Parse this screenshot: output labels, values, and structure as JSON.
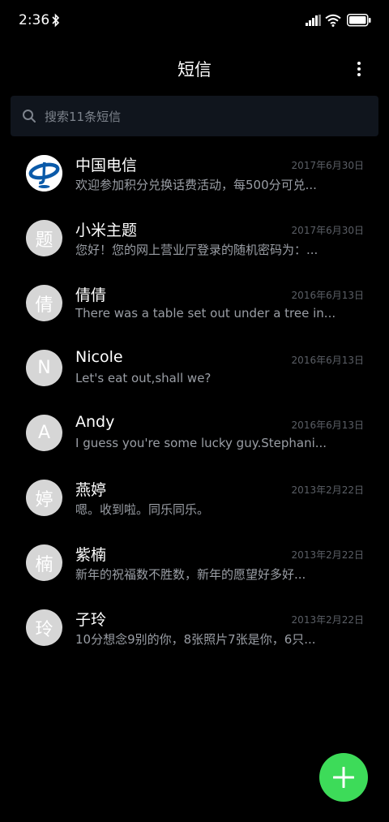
{
  "status_bar": {
    "time": "2:36",
    "icons": [
      "bluetooth-icon",
      "signal-icon",
      "wifi-icon",
      "battery-icon"
    ]
  },
  "header": {
    "title": "短信",
    "more_icon": "more-vertical-icon"
  },
  "search": {
    "placeholder": "搜索11条短信",
    "icon": "search-icon"
  },
  "threads": [
    {
      "name": "中国电信",
      "date": "2017年6月30日",
      "preview": "欢迎参加积分兑换话费活动，每500分可兑...",
      "avatar": "",
      "avatar_type": "china-telecom-logo"
    },
    {
      "name": "小米主题",
      "date": "2017年6月30日",
      "preview": "您好！您的网上营业厅登录的随机密码为：...",
      "avatar": "题"
    },
    {
      "name": "倩倩",
      "date": "2016年6月13日",
      "preview": "There was a table set out under a tree in...",
      "avatar": "倩"
    },
    {
      "name": "Nicole",
      "date": "2016年6月13日",
      "preview": "Let's eat out,shall we?",
      "avatar": "N"
    },
    {
      "name": "Andy",
      "date": "2016年6月13日",
      "preview": "I guess you're some lucky guy.Stephani...",
      "avatar": "A"
    },
    {
      "name": "燕婷",
      "date": "2013年2月22日",
      "preview": "嗯。收到啦。同乐同乐。",
      "avatar": "婷"
    },
    {
      "name": "紫楠",
      "date": "2013年2月22日",
      "preview": "新年的祝福数不胜数，新年的愿望好多好...",
      "avatar": "楠"
    },
    {
      "name": "子玲",
      "date": "2013年2月22日",
      "preview": "10分想念9别的你，8张照片7张是你，6只...",
      "avatar": "玲"
    }
  ],
  "fab": {
    "icon": "plus-icon",
    "color": "#3ddb59"
  },
  "colors": {
    "background": "#000000",
    "search_bg": "#10151d",
    "avatar_bg": "#d6d6d6",
    "telecom_blue": "#0a5aa9"
  }
}
